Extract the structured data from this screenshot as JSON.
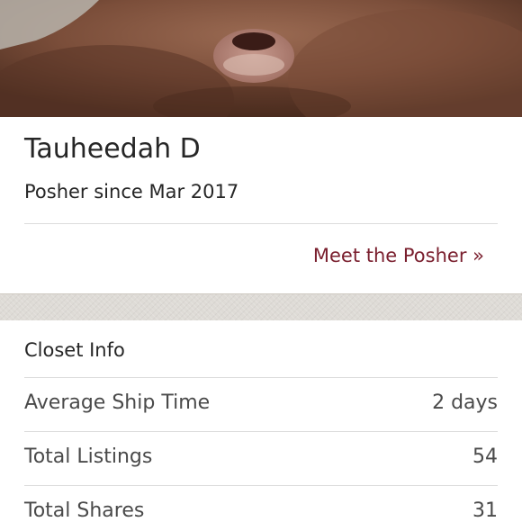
{
  "profile": {
    "photo_icon": "profile-photo",
    "name": "Tauheedah D",
    "since": "Posher since Mar 2017",
    "meet_link": "Meet the Posher »"
  },
  "closet": {
    "title": "Closet Info",
    "stats": [
      {
        "label": "Average Ship Time",
        "value": "2 days"
      },
      {
        "label": "Total Listings",
        "value": "54"
      },
      {
        "label": "Total Shares",
        "value": "31"
      }
    ]
  },
  "colors": {
    "link": "#7a1f2e",
    "text": "#262626",
    "muted_text": "#4a4a4a",
    "divider": "#dcdcdc",
    "texture": "#dedbd6"
  }
}
